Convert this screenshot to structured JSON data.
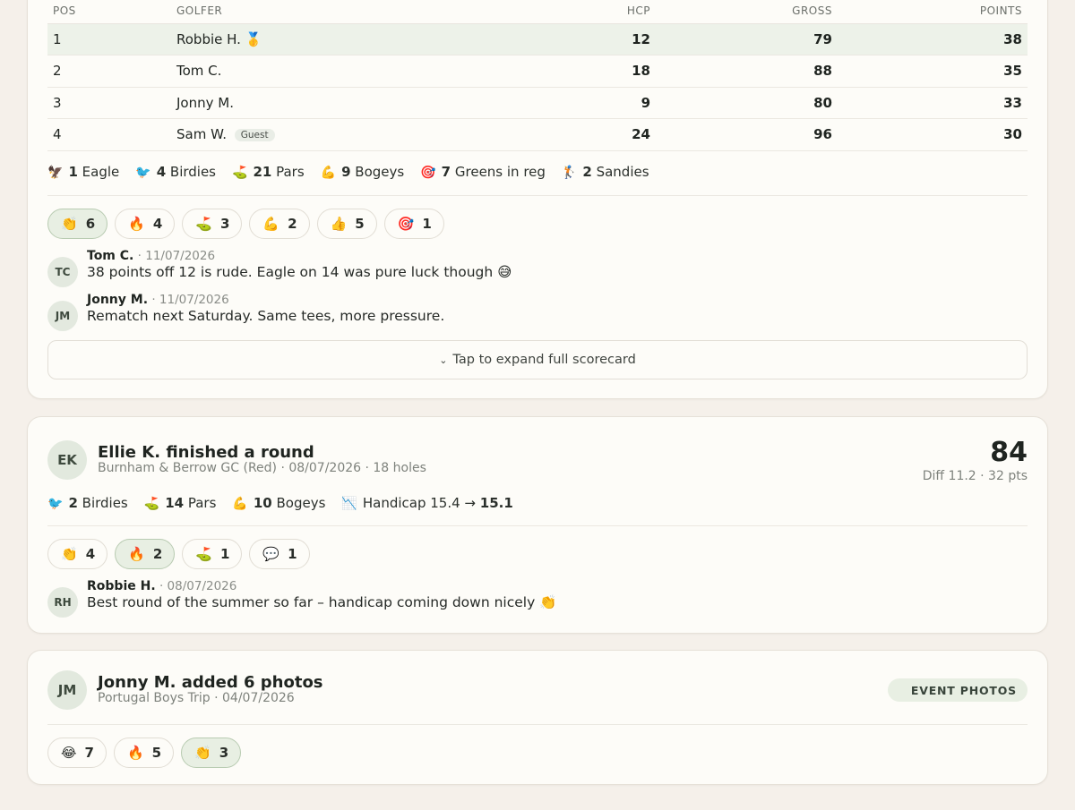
{
  "card1": {
    "table": {
      "headers": [
        "POS",
        "GOLFER",
        "HCP",
        "GROSS",
        "POINTS"
      ],
      "rows": [
        {
          "pos": "1",
          "golfer": "Robbie H. 🥇",
          "guest": "",
          "hcp": "12",
          "gross": "79",
          "points": "38"
        },
        {
          "pos": "2",
          "golfer": "Tom C.",
          "guest": "",
          "hcp": "18",
          "gross": "88",
          "points": "35"
        },
        {
          "pos": "3",
          "golfer": "Jonny M.",
          "guest": "",
          "hcp": "9",
          "gross": "80",
          "points": "33"
        },
        {
          "pos": "4",
          "golfer": "Sam W.",
          "guest": "Guest",
          "hcp": "24",
          "gross": "96",
          "points": "30"
        }
      ]
    },
    "stats": [
      {
        "icon": "🦅",
        "count": "1",
        "label": "Eagle"
      },
      {
        "icon": "🐦",
        "count": "4",
        "label": "Birdies"
      },
      {
        "icon": "⛳",
        "count": "21",
        "label": "Pars"
      },
      {
        "icon": "💪",
        "count": "9",
        "label": "Bogeys"
      },
      {
        "icon": "🎯",
        "count": "7",
        "label": "Greens in reg"
      },
      {
        "icon": "🏌",
        "count": "2",
        "label": "Sandies"
      }
    ],
    "reactions": [
      {
        "emoji": "👏",
        "count": "6",
        "active": true
      },
      {
        "emoji": "🔥",
        "count": "4",
        "active": false
      },
      {
        "emoji": "⛳",
        "count": "3",
        "active": false
      },
      {
        "emoji": "💪",
        "count": "2",
        "active": false
      },
      {
        "emoji": "👍",
        "count": "5",
        "active": false
      },
      {
        "emoji": "🎯",
        "count": "1",
        "active": false
      }
    ],
    "comments": [
      {
        "initials": "TC",
        "name": "Tom C.",
        "date": "· 11/07/2026",
        "text": "38 points off 12 is rude. Eagle on 14 was pure luck though 😅"
      },
      {
        "initials": "JM",
        "name": "Jonny M.",
        "date": "· 11/07/2026",
        "text": "Rematch next Saturday. Same tees, more pressure."
      }
    ],
    "expand_label": "Tap to expand full scorecard"
  },
  "card2": {
    "initials": "EK",
    "title": "Ellie K. finished a round",
    "subtitle": "Burnham & Berrow GC (Red) · 08/07/2026 · 18 holes",
    "score": "84",
    "score_sub": "Diff 11.2 · 32 pts",
    "stats": [
      {
        "icon": "🐦",
        "count": "2",
        "label": "Birdies"
      },
      {
        "icon": "⛳",
        "count": "14",
        "label": "Pars"
      },
      {
        "icon": "💪",
        "count": "10",
        "label": "Bogeys"
      }
    ],
    "handicap": {
      "icon": "📉",
      "label": "Handicap 15.4 →",
      "value": "15.1"
    },
    "reactions": [
      {
        "emoji": "👏",
        "count": "4",
        "active": false
      },
      {
        "emoji": "🔥",
        "count": "2",
        "active": true
      },
      {
        "emoji": "⛳",
        "count": "1",
        "active": false
      },
      {
        "emoji": "💬",
        "count": "1",
        "active": false
      }
    ],
    "comment": {
      "initials": "RH",
      "name": "Robbie H.",
      "date": "· 08/07/2026",
      "text": "Best round of the summer so far – handicap coming down nicely 👏"
    }
  },
  "card3": {
    "initials": "JM",
    "title": "Jonny M. added 6 photos",
    "subtitle": "Portugal Boys Trip · 04/07/2026",
    "badge": "EVENT PHOTOS",
    "reactions": [
      {
        "emoji": "😂",
        "count": "7",
        "active": false
      },
      {
        "emoji": "🔥",
        "count": "5",
        "active": false
      },
      {
        "emoji": "👏",
        "count": "3",
        "active": true
      }
    ]
  }
}
